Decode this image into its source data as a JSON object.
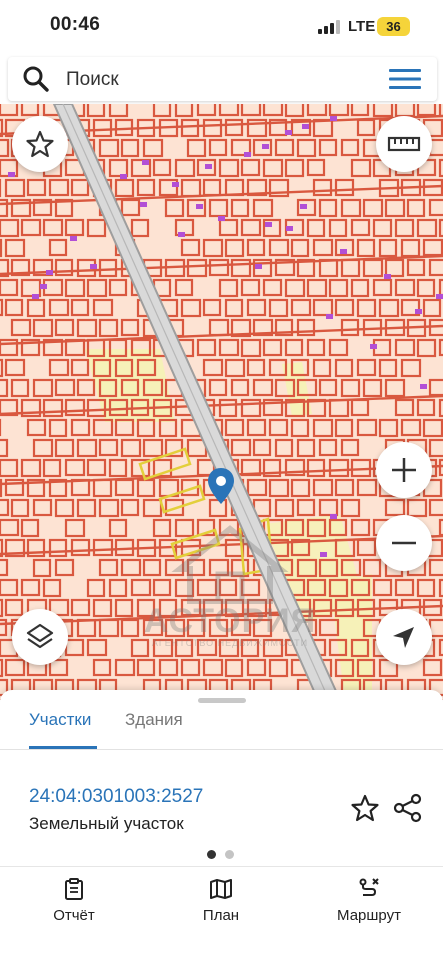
{
  "status_bar": {
    "time": "00:46",
    "network": "LTE",
    "battery": "36"
  },
  "search": {
    "placeholder": "Поиск"
  },
  "map": {
    "watermark_title": "АСТОРИЯ",
    "watermark_subtitle": "АГЕНТСТВО НЕДВИЖИМОСТИ",
    "colors": {
      "parcel_line": "#d9583f",
      "parcel_fill": "#fde3d3",
      "road": "#9e9e9e",
      "zone": "#f6f1b8",
      "building": "#b24fd6"
    }
  },
  "sheet": {
    "tabs": [
      {
        "label": "Участки",
        "active": true
      },
      {
        "label": "Здания",
        "active": false
      }
    ],
    "cadastral_number": "24:04:0301003:2527",
    "parcel_type": "Земельный участок",
    "page": 1,
    "pages": 2
  },
  "bottom_nav": [
    {
      "label": "Отчёт",
      "icon": "clipboard-icon"
    },
    {
      "label": "План",
      "icon": "map-icon"
    },
    {
      "label": "Маршрут",
      "icon": "route-icon"
    }
  ],
  "accent_color": "#2a74b8"
}
